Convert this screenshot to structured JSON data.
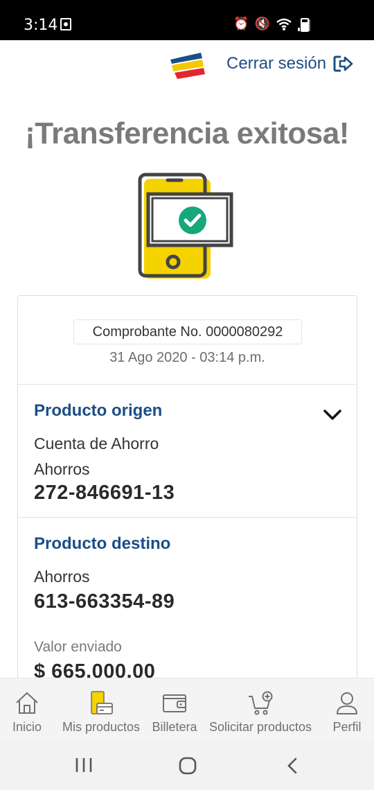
{
  "status_bar": {
    "time": "3:14",
    "icons": [
      "alarm-icon",
      "mute-icon",
      "wifi-icon",
      "signal-icon",
      "battery-icon"
    ]
  },
  "header": {
    "logout_label": "Cerrar sesión",
    "brand_colors": [
      "#1c4e86",
      "#f5c800",
      "#e5242c"
    ]
  },
  "page": {
    "title": "¡Transferencia exitosa!"
  },
  "receipt": {
    "number_label": "Comprobante No. 0000080292",
    "date": "31 Ago 2020 - 03:14 p.m."
  },
  "origin": {
    "title": "Producto origen",
    "product_name": "Cuenta de Ahorro",
    "account_type": "Ahorros",
    "account_number": "272-846691-13"
  },
  "destination": {
    "title": "Producto destino",
    "account_type": "Ahorros",
    "account_number": "613-663354-89"
  },
  "amount": {
    "label": "Valor enviado",
    "value": "$ 665.000,00"
  },
  "bottom_nav": {
    "items": [
      {
        "label": "Inicio",
        "icon": "home-icon"
      },
      {
        "label": "Mis productos",
        "icon": "products-icon"
      },
      {
        "label": "Billetera",
        "icon": "wallet-icon"
      },
      {
        "label": "Solicitar productos",
        "icon": "cart-add-icon"
      },
      {
        "label": "Perfil",
        "icon": "profile-icon"
      }
    ]
  },
  "colors": {
    "primary_blue": "#1c4e86",
    "accent_yellow": "#f5d300",
    "success_green": "#16a87a",
    "title_gray": "#7a7a7a"
  }
}
